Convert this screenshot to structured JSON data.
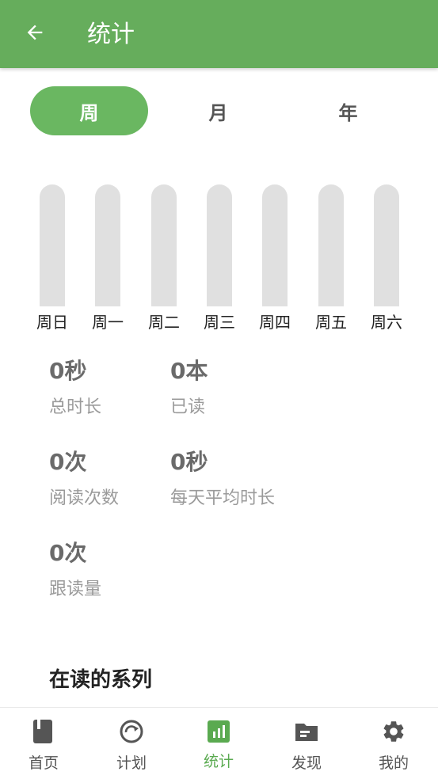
{
  "header": {
    "title": "统计",
    "back_icon": "arrow-left-icon"
  },
  "period_tabs": [
    {
      "label": "周",
      "active": true
    },
    {
      "label": "月",
      "active": false
    },
    {
      "label": "年",
      "active": false
    }
  ],
  "chart_data": {
    "type": "bar",
    "categories": [
      "周日",
      "周一",
      "周二",
      "周三",
      "周四",
      "周五",
      "周六"
    ],
    "values": [
      0,
      0,
      0,
      0,
      0,
      0,
      0
    ]
  },
  "stats": [
    {
      "value": "0秒",
      "label": "总时长"
    },
    {
      "value": "0本",
      "label": "已读"
    },
    {
      "value": "0次",
      "label": "阅读次数"
    },
    {
      "value": "0秒",
      "label": "每天平均时长"
    },
    {
      "value": "0次",
      "label": "跟读量"
    }
  ],
  "section": {
    "title": "在读的系列"
  },
  "bottom_nav": [
    {
      "label": "首页",
      "icon": "book-icon",
      "active": false
    },
    {
      "label": "计划",
      "icon": "refresh-clock-icon",
      "active": false
    },
    {
      "label": "统计",
      "icon": "bar-chart-icon",
      "active": true
    },
    {
      "label": "发现",
      "icon": "folder-icon",
      "active": false
    },
    {
      "label": "我的",
      "icon": "gear-icon",
      "active": false
    }
  ],
  "colors": {
    "primary": "#66ad5c",
    "accent": "#6ab761",
    "track": "#e0e0e0"
  }
}
